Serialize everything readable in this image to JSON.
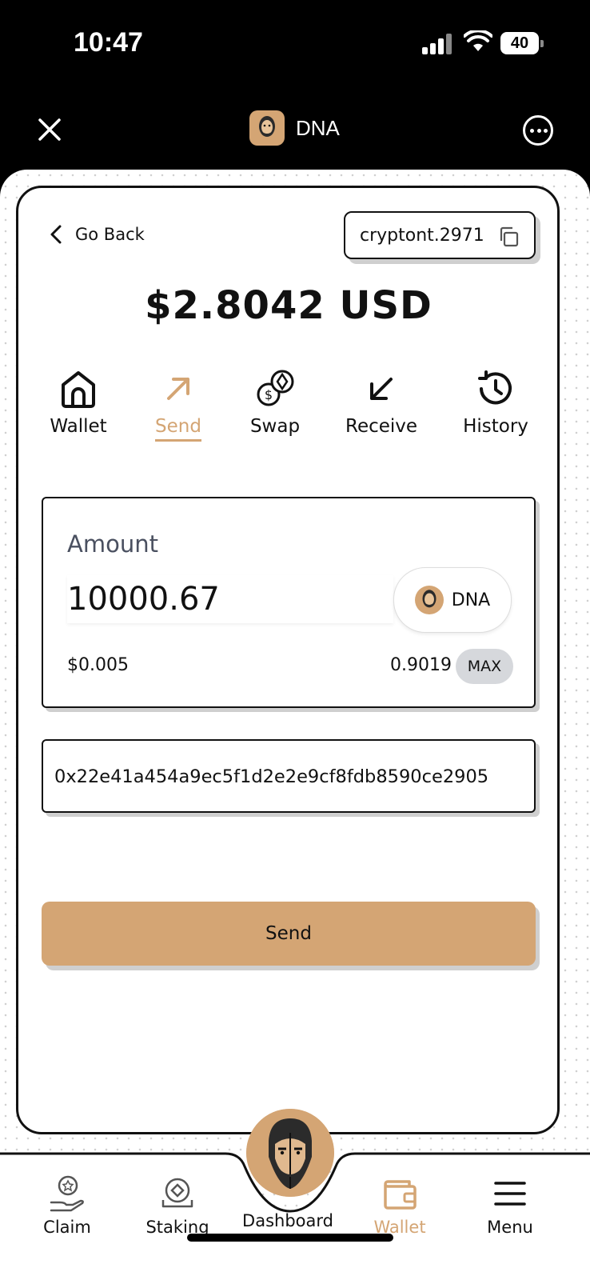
{
  "status_bar": {
    "time": "10:47",
    "battery": "40"
  },
  "header": {
    "title": "DNA"
  },
  "navigation": {
    "go_back": "Go Back",
    "account": "cryptont.2971"
  },
  "balance": "$2.8042 USD",
  "tabs": [
    {
      "label": "Wallet",
      "icon": "home-icon"
    },
    {
      "label": "Send",
      "icon": "arrow-up-right-icon",
      "active": true
    },
    {
      "label": "Swap",
      "icon": "swap-coins-icon"
    },
    {
      "label": "Receive",
      "icon": "arrow-down-left-icon"
    },
    {
      "label": "History",
      "icon": "history-icon"
    }
  ],
  "send_form": {
    "amount_label": "Amount",
    "amount_value": "10000.67",
    "token": "DNA",
    "usd_value": "$0.005",
    "available_balance": "0.9019",
    "max_label": "MAX",
    "recipient_address": "0x22e41a454a9ec5f1d2e2e9cf8fdb8590ce2905",
    "send_label": "Send"
  },
  "bottom_nav": [
    {
      "label": "Claim",
      "icon": "claim-award-icon"
    },
    {
      "label": "Staking",
      "icon": "staking-icon"
    },
    {
      "label": "Dashboard",
      "icon": "avatar-logo"
    },
    {
      "label": "Wallet",
      "icon": "wallet-icon",
      "active": true
    },
    {
      "label": "Menu",
      "icon": "hamburger-menu-icon"
    }
  ],
  "colors": {
    "accent": "#d4a574",
    "border": "#111111",
    "shadow": "#cfcfcf",
    "muted_label": "#4a5060"
  }
}
